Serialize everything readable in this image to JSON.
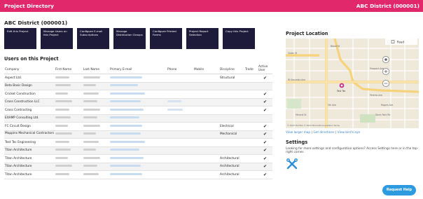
{
  "header": {
    "title": "Project Directory",
    "right_title": "ABC District (000001)"
  },
  "district_title": "ABC District (000001)",
  "actions": [
    "Edit this Project",
    "Manage Users on this Project",
    "Configure E-mail Subscriptions",
    "Manage Distribution Groups",
    "Configure Printed Forms",
    "Project Report Selection",
    "Copy this Project"
  ],
  "users_title": "Users on this Project",
  "columns": [
    "Company",
    "First Name",
    "Last Name",
    "Primary E-mail",
    "Phone",
    "Mobile",
    "Discipline",
    "Trade",
    "Active User"
  ],
  "rows": [
    {
      "company": "Aspect Ltd.",
      "discipline": "Structural",
      "active": "✔",
      "phone": false
    },
    {
      "company": "Beta Basic Design",
      "discipline": "",
      "active": "",
      "phone": false
    },
    {
      "company": "Cricket Construction",
      "discipline": "",
      "active": "✔",
      "phone": false
    },
    {
      "company": "Cross Construction LLC",
      "discipline": "",
      "active": "✔",
      "phone": true
    },
    {
      "company": "Cross Contracting",
      "discipline": "",
      "active": "✔",
      "phone": true
    },
    {
      "company": "EXAMP Consulting Ltd.",
      "discipline": "",
      "active": "",
      "phone": false
    },
    {
      "company": "FC Circuit Design",
      "discipline": "Electrical",
      "active": "✔",
      "phone": false
    },
    {
      "company": "Moppins Mechanical Contractors",
      "discipline": "Mechanical",
      "active": "✔",
      "phone": false
    },
    {
      "company": "Test Tec Engineering",
      "discipline": "",
      "active": "✔",
      "phone": false
    },
    {
      "company": "Titan Architecture",
      "discipline": "",
      "active": "✔",
      "phone": false
    },
    {
      "company": "Titan Architecture",
      "discipline": "Architectural",
      "active": "✔",
      "phone": false
    },
    {
      "company": "Titan Architecture",
      "discipline": "Architectural",
      "active": "✔",
      "phone": false
    },
    {
      "company": "Titan Architecture",
      "discipline": "Architectural",
      "active": "✔",
      "phone": false
    }
  ],
  "project_location": {
    "title": "Project Location",
    "map_type": "Road",
    "pin_label": "Test Tec",
    "attribution": "© 2022 TomTom  © 2022 Microsoft Corporation  Terms",
    "links": [
      "View larger map",
      "Get directions",
      "View bird's eye"
    ],
    "labels": {
      "st": "Slater St",
      "bland": "Bland St",
      "gonzalez": "W Gonzalez Ave",
      "prospect": "Prospect Ave",
      "fifth": "5th Ave",
      "perkins": "Perkins Ave",
      "rogers": "Rogers Ave",
      "jk": "Davis Park Rd",
      "cross": "Mineral St"
    }
  },
  "settings": {
    "title": "Settings",
    "text": "Looking for more settings and configuration options? Access Settings here or in the top-right corner."
  },
  "request_help": "Request Help",
  "colors": {
    "header": "#e1286b",
    "button": "#1e1b3a",
    "link": "#3a82c5",
    "help": "#2e9be0"
  }
}
